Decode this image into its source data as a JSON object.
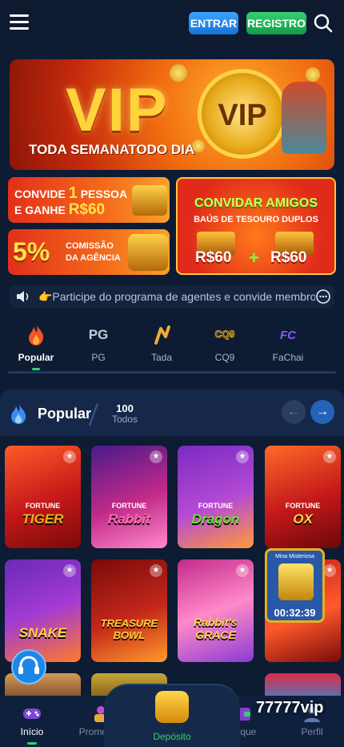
{
  "header": {
    "entrar_label": "ENTRAR",
    "registro_label": "REGISTRO",
    "icons": [
      "menu-icon",
      "search-icon"
    ]
  },
  "banners": {
    "vip": {
      "big_text": "VIP",
      "coin_text": "VIP",
      "subtitle": "TODA SEMANATODO DIA"
    },
    "convide": {
      "line1_pre": "CONVIDE",
      "line1_num": "1",
      "line1_post": "PESSOA",
      "line2_pre": "E GANHE",
      "line2_amount": "R$60"
    },
    "comissao": {
      "percent": "5%",
      "line1": "COMISSÃO",
      "line2": "DA AGÊNCIA"
    },
    "convidar": {
      "title": "CONVIDAR AMIGOS",
      "subtitle": "BAÚS DE TESOURO DUPLOS",
      "amount1": "R$60",
      "plus": "+",
      "amount2": "R$60"
    }
  },
  "marquee": {
    "text": "👉Participe do programa de agentes e convide membros"
  },
  "categories": [
    {
      "label": "Popular",
      "active": true,
      "icon": "flame-icon"
    },
    {
      "label": "PG",
      "active": false,
      "icon": "pg-logo-icon"
    },
    {
      "label": "Tada",
      "active": false,
      "icon": "tada-logo-icon"
    },
    {
      "label": "CQ9",
      "active": false,
      "icon": "cq9-logo-icon"
    },
    {
      "label": "FaChai",
      "active": false,
      "icon": "fachai-logo-icon"
    }
  ],
  "section": {
    "title": "Popular",
    "count": "100",
    "todos": "Todos"
  },
  "games": [
    {
      "prefix": "FORTUNE",
      "title": "TIGER",
      "color": "#e8b020"
    },
    {
      "prefix": "FORTUNE",
      "title": "Rabbit",
      "color": "#ff6ab4"
    },
    {
      "prefix": "FORTUNE",
      "title": "Dragon",
      "color": "#6adc3a"
    },
    {
      "prefix": "FORTUNE",
      "title": "OX",
      "color": "#ffd24a"
    },
    {
      "prefix": "",
      "title": "SNAKE",
      "color": "#ffd24a"
    },
    {
      "prefix": "",
      "title": "TREASURE BOWL",
      "color": "#ffcc3a"
    },
    {
      "prefix": "",
      "title": "Rabbit's GRACE",
      "color": "#ffd24a"
    },
    {
      "prefix": "",
      "title": "",
      "color": "#ffd24a"
    }
  ],
  "timer": {
    "label": "Mina Misteriosa",
    "value": "00:32:39"
  },
  "bottom_nav": [
    {
      "label": "Início",
      "active": true,
      "icon": "gamepad-icon"
    },
    {
      "label": "Promoção",
      "active": false,
      "icon": "gift-icon"
    },
    {
      "label": "Saque",
      "active": false,
      "icon": "wallet-icon"
    },
    {
      "label": "Perfil",
      "active": false,
      "icon": "user-icon"
    }
  ],
  "deposit": {
    "label": "Depósito",
    "icon": "money-bag-icon"
  },
  "brand": {
    "text": "77777vip"
  },
  "colors": {
    "accent_green": "#2fd46a",
    "accent_blue": "#1673d8",
    "background": "#0d1b33"
  }
}
